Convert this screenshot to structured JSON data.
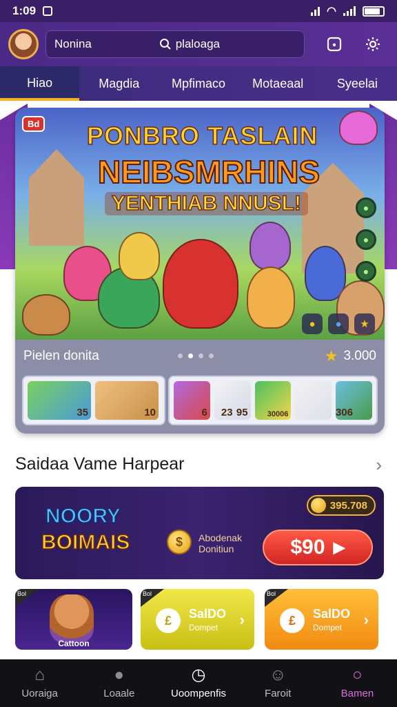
{
  "status_bar": {
    "time": "1:09",
    "notification_icon": "notification-icon"
  },
  "top_bar": {
    "profile_name": "Nonina",
    "search_text": "plaloaga",
    "icons": [
      "search-icon",
      "inbox-icon",
      "settings-icon"
    ]
  },
  "tabs": [
    {
      "label": "Hiao",
      "active": true
    },
    {
      "label": "Magdia",
      "active": false
    },
    {
      "label": "Mpfimaco",
      "active": false
    },
    {
      "label": "Motaeaal",
      "active": false
    },
    {
      "label": "Syeelai",
      "active": false
    }
  ],
  "hero": {
    "badge": "Bd",
    "title_line1": "PONBRO TASLAIN",
    "title_line2": "NEIBSMRHINS",
    "title_line3": "YENTHIAB NNUSL!",
    "card_title": "Pielen donita",
    "rating_value": "3.000",
    "slide_index": 2,
    "slide_count": 4,
    "thumb_group1": [
      "35",
      "10"
    ],
    "thumb_group2": [
      "6",
      "23",
      "95",
      "30006",
      "306"
    ]
  },
  "section": {
    "title": "Saidaa Vame Harpear"
  },
  "promo": {
    "logo_line1": "NOORY",
    "logo_line2": "BOIMAIS",
    "coin_amount": "395.708",
    "text_line1": "Abodenak",
    "text_line2": "Donitiun",
    "price": "$90"
  },
  "small_cards": [
    {
      "tag": "Bol",
      "label": "Cattoon"
    },
    {
      "tag": "Bol",
      "title": "SalDO",
      "subtitle": "Dompet"
    },
    {
      "tag": "Bol",
      "title": "SalDO",
      "subtitle": "Dompet"
    }
  ],
  "bottom_nav": [
    {
      "label": "Uoraiga",
      "icon": "home-icon"
    },
    {
      "label": "Loaale",
      "icon": "gamepad-icon"
    },
    {
      "label": "Uoompenfis",
      "icon": "clock-icon",
      "active": true
    },
    {
      "label": "Faroit",
      "icon": "user-icon"
    },
    {
      "label": "Bamen",
      "icon": "search-icon",
      "highlight": true
    }
  ],
  "colors": {
    "header_purple": "#4b2a87",
    "accent_gold": "#f4b21e",
    "price_red": "#e32c2c",
    "nav_pink": "#e06adf"
  }
}
